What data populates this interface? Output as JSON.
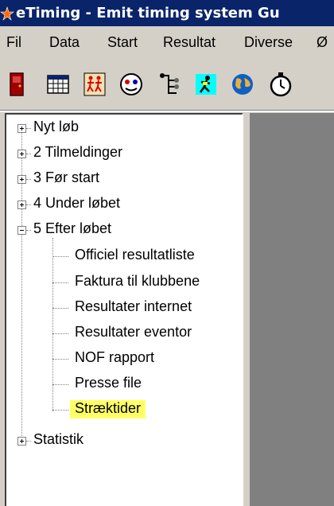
{
  "titlebar": {
    "title": "eTiming - Emit timing system  Gu"
  },
  "menu": {
    "items": [
      "Fil",
      "Data",
      "Start",
      "Resultat",
      "Diverse",
      "Ø"
    ]
  },
  "toolbar": {
    "icons": [
      "door-icon",
      "calendar-grid-icon",
      "runners-icon",
      "clock-face-icon",
      "tree-icon",
      "runner-icon",
      "globe-icon",
      "stopwatch-icon"
    ]
  },
  "tree": {
    "nodes": [
      {
        "label": "Nyt løb",
        "state": "collapsed"
      },
      {
        "label": "2 Tilmeldinger",
        "state": "collapsed"
      },
      {
        "label": "3 Før start",
        "state": "collapsed"
      },
      {
        "label": "4 Under løbet",
        "state": "collapsed"
      },
      {
        "label": "5 Efter løbet",
        "state": "expanded",
        "children": [
          "Officiel resultatliste",
          "Faktura til klubbene",
          "Resultater internet",
          "Resultater eventor",
          "NOF rapport",
          "Presse file",
          "Stræktider"
        ]
      },
      {
        "label": "Statistik",
        "state": "collapsed"
      }
    ],
    "highlighted": "Stræktider"
  },
  "colors": {
    "titlebar": "#0a246a",
    "highlight": "#ffff66",
    "background": "#d4d0c8"
  }
}
